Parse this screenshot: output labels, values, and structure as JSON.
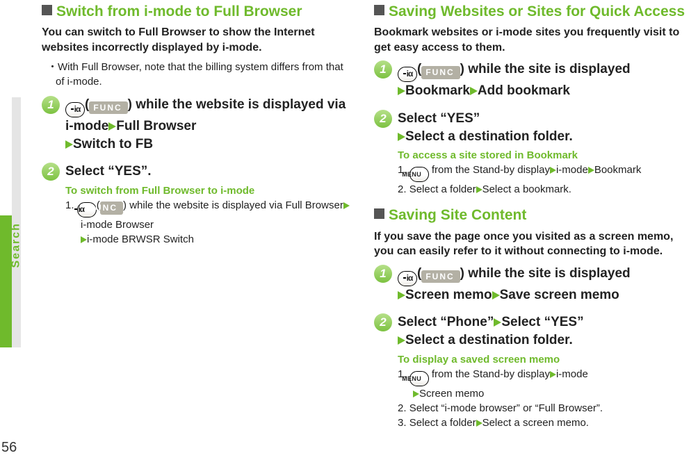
{
  "pageNumber": "56",
  "sideTab": "Search",
  "icons": {
    "func": "FUNC",
    "menu": "MENU"
  },
  "left": {
    "h1": "Switch from i-mode to Full Browser",
    "lede": "You can switch to Full Browser to show the Internet websites incorrectly displayed by i-mode.",
    "note": "With Full Browser, note that the billing system differs from that of i-mode.",
    "step1": {
      "a": "while the website is displayed via i-mode",
      "b": "Full Browser",
      "c": "Switch to FB"
    },
    "step2": {
      "title": "Select “YES”.",
      "sub": "To switch from Full Browser to i-mode",
      "s1a": "while the website is displayed via Full Browser",
      "s1b": "i-mode Browser",
      "s1c": "i-mode BRWSR Switch"
    }
  },
  "right": {
    "h1": "Saving Websites or Sites for Quick Access",
    "lede": "Bookmark websites or i-mode sites you frequently visit to get easy access to them.",
    "step1": {
      "a": "while the site is displayed",
      "b": "Bookmark",
      "c": "Add bookmark"
    },
    "step2": {
      "a": "Select “YES”",
      "b": "Select a destination folder.",
      "sub": "To access a site stored in Bookmark",
      "s1a": "from the Stand-by display",
      "s1b": "i-mode",
      "s1c": "Bookmark",
      "s2a": "Select a folder",
      "s2b": "Select a bookmark."
    },
    "h2": "Saving Site Content",
    "lede2": "If you save the page once you visited as a screen memo, you can easily refer to it without connecting to i-mode.",
    "scStep1": {
      "a": "while the site is displayed",
      "b": "Screen memo",
      "c": "Save screen memo"
    },
    "scStep2": {
      "a": "Select “Phone”",
      "b": "Select “YES”",
      "c": "Select a destination folder.",
      "sub": "To display a saved screen memo",
      "s1a": "from the Stand-by display",
      "s1b": "i-mode",
      "s1c": "Screen memo",
      "s2": "Select “i-mode browser” or “Full Browser”.",
      "s3a": "Select a folder",
      "s3b": "Select a screen memo."
    }
  }
}
